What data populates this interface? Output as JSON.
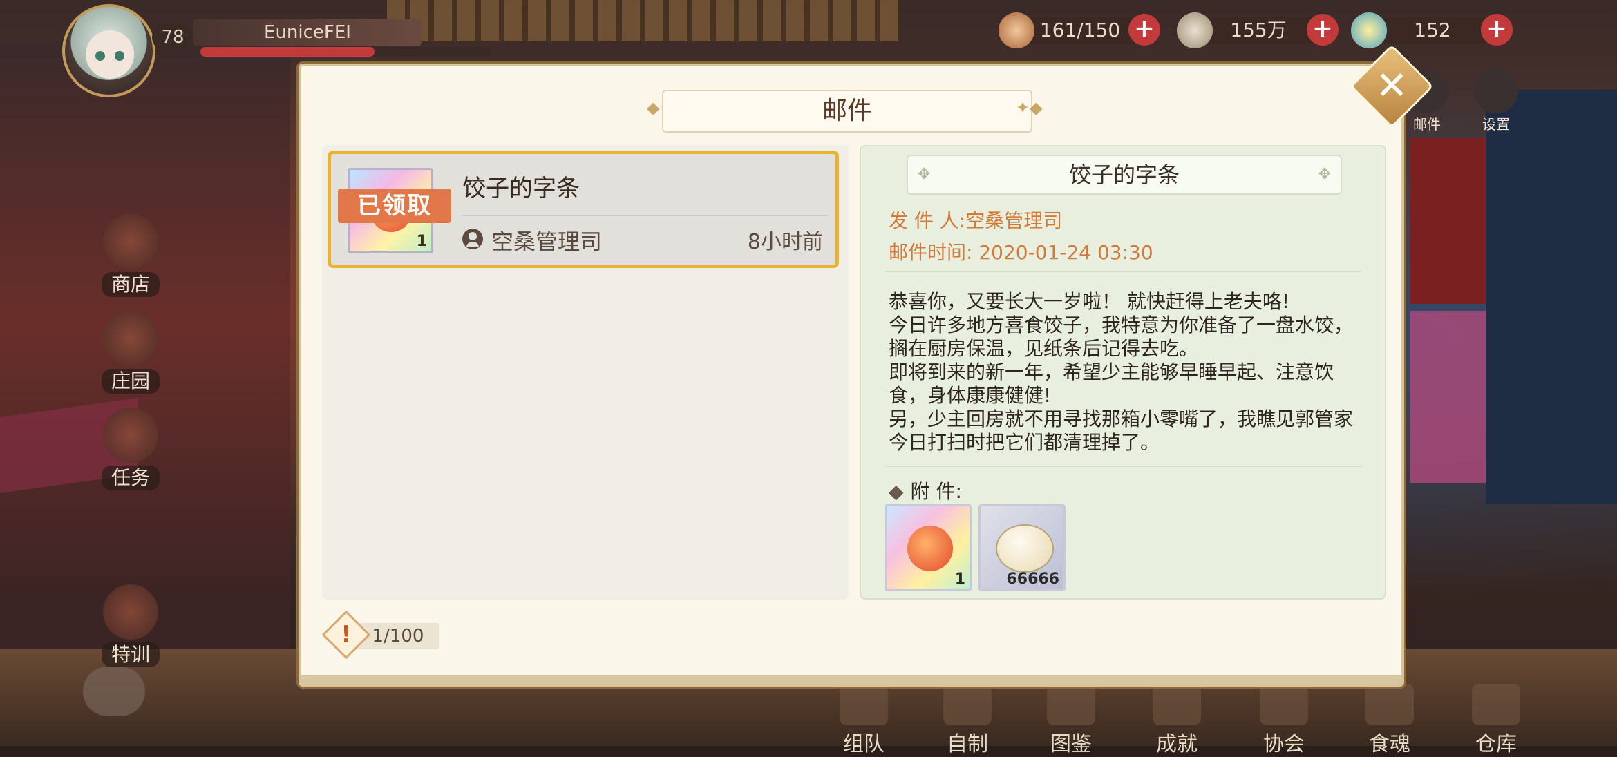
{
  "player": {
    "level": "78",
    "name": "EuniceFEI"
  },
  "resources": [
    {
      "icon": "rice-bowl-icon",
      "value": "161/150"
    },
    {
      "icon": "feather-icon",
      "value": "155万"
    },
    {
      "icon": "coin-icon",
      "value": "152"
    }
  ],
  "side_menu": [
    {
      "key": "shop",
      "label": "商店"
    },
    {
      "key": "manor",
      "label": "庄园"
    },
    {
      "key": "task",
      "label": "任务"
    },
    {
      "key": "training",
      "label": "特训"
    }
  ],
  "top_right": [
    {
      "key": "mail",
      "label": "邮件"
    },
    {
      "key": "settings",
      "label": "设置"
    }
  ],
  "bottom_menu": [
    {
      "key": "team",
      "label": "组队"
    },
    {
      "key": "craft",
      "label": "自制"
    },
    {
      "key": "atlas",
      "label": "图鉴"
    },
    {
      "key": "achievement",
      "label": "成就"
    },
    {
      "key": "guild",
      "label": "协会"
    },
    {
      "key": "soul",
      "label": "食魂"
    },
    {
      "key": "warehouse",
      "label": "仓库"
    }
  ],
  "dialog": {
    "title": "邮件",
    "mail_list": [
      {
        "title": "饺子的字条",
        "status": "已领取",
        "sender": "空桑管理司",
        "time": "8小时前",
        "qty": "1"
      }
    ],
    "detail": {
      "title": "饺子的字条",
      "sender_label": "发 件 人:",
      "sender": "空桑管理司",
      "time_label": "邮件时间:",
      "time": "2020-01-24 03:30",
      "body": [
        "恭喜你，又要长大一岁啦！ 就快赶得上老夫咯!",
        "今日许多地方喜食饺子，我特意为你准备了一盘水饺，搁在厨房保温，见纸条后记得去吃。",
        "即将到来的新一年，希望少主能够早睡早起、注意饮食，身体康康健健!",
        "另，少主回房就不用寻找那箱小零嘴了，我瞧见郭管家今日打扫时把它们都清理掉了。"
      ],
      "attachments_label": "附      件:",
      "attachments": [
        {
          "icon": "red-pepper-charm-icon",
          "qty": "1"
        },
        {
          "icon": "cowrie-shell-icon",
          "qty": "66666"
        }
      ]
    },
    "counter": "1/100"
  },
  "colors": {
    "accent_gold": "#e8b32e",
    "claimed_tag": "#e2784a",
    "meta_orange": "#d27a3a",
    "close_gold": "#d8a058"
  }
}
